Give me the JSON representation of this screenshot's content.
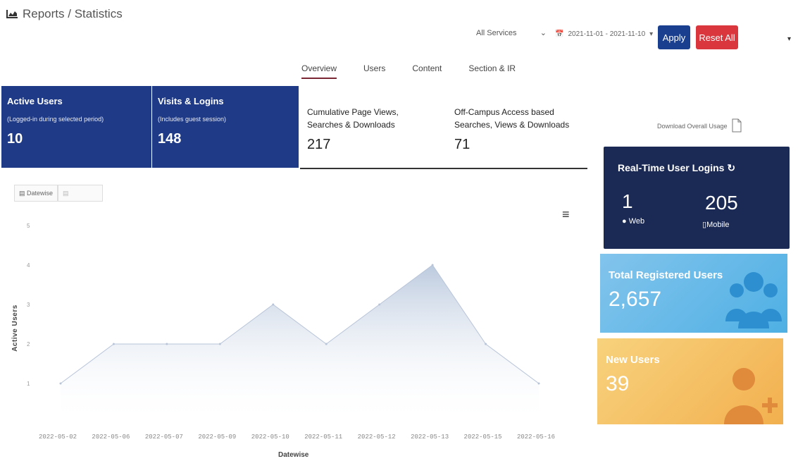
{
  "header": {
    "title": "Reports / Statistics",
    "services_select": "All Services",
    "date_range": "2021-11-01 - 2021-11-10",
    "apply_label": "Apply",
    "reset_label": "Reset All"
  },
  "tabs": [
    "Overview",
    "Users",
    "Content",
    "Section & IR"
  ],
  "metrics": [
    {
      "title": "Active Users",
      "sub": "(Logged-in during selected period)",
      "value": "10"
    },
    {
      "title": "Visits & Logins",
      "sub": "(Includes guest session)",
      "value": "148"
    },
    {
      "title": "Cumulative Page Views,",
      "title2": "Searches & Downloads",
      "value": "217"
    },
    {
      "title": "Off-Campus Access based",
      "title2": "Searches, Views & Downloads",
      "value": "71"
    }
  ],
  "download_label": "Download Overall Usage",
  "chart_controls": {
    "datewise_label": "Datewise"
  },
  "realtime": {
    "title": "Real-Time User Logins",
    "web_count": "1",
    "web_label": "Web",
    "mobile_count": "205",
    "mobile_label": "Mobile"
  },
  "registered": {
    "title": "Total Registered Users",
    "value": "2,657"
  },
  "new_users": {
    "title": "New Users",
    "value": "39"
  },
  "colors": {
    "primary": "#1f3a86",
    "apply": "#1b3f8f",
    "reset": "#d9363e",
    "realtime": "#1b2a55",
    "registered": "#5ab5e6",
    "new_users": "#f4bd5c"
  },
  "chart_data": {
    "type": "area",
    "x": [
      "2022-05-02",
      "2022-05-06",
      "2022-05-07",
      "2022-05-09",
      "2022-05-10",
      "2022-05-11",
      "2022-05-12",
      "2022-05-13",
      "2022-05-15",
      "2022-05-16"
    ],
    "values": [
      1,
      2,
      2,
      2,
      3,
      2,
      3,
      4,
      2,
      1
    ],
    "xlabel": "Datewise",
    "ylabel": "Active Users",
    "ylim": [
      0,
      5
    ],
    "yticks": [
      "1",
      "2",
      "3",
      "4",
      "5"
    ]
  }
}
